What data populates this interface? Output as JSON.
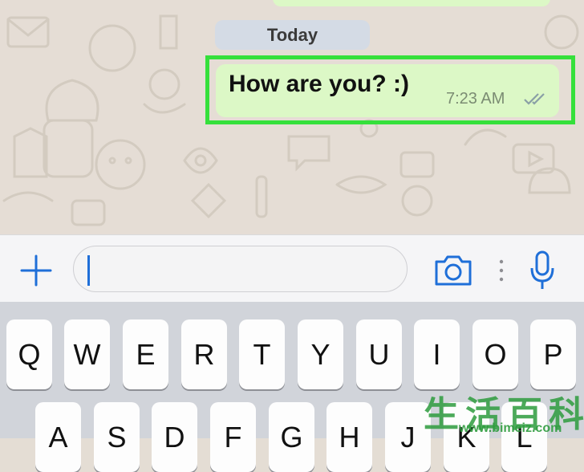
{
  "chat": {
    "date_label": "Today",
    "message": {
      "text": "How are you? :)",
      "time": "7:23 AM",
      "status_icon": "double-check-icon"
    }
  },
  "input_bar": {
    "plus_icon": "plus-icon",
    "text_value": "",
    "camera_icon": "camera-icon",
    "more_icon": "vertical-dots-icon",
    "mic_icon": "microphone-icon"
  },
  "keyboard": {
    "row1": [
      "Q",
      "W",
      "E",
      "R",
      "T",
      "Y",
      "U",
      "I",
      "O",
      "P"
    ],
    "row2": [
      "A",
      "S",
      "D",
      "F",
      "G",
      "H",
      "J",
      "K",
      "L"
    ]
  },
  "watermark": {
    "chinese": "生活百科",
    "url": "www.bimeiz.com"
  },
  "colors": {
    "accent": "#1f6fd8",
    "bubble": "#dcf8c6",
    "highlight": "#35e03b",
    "wallpaper": "#e5ddd5"
  }
}
